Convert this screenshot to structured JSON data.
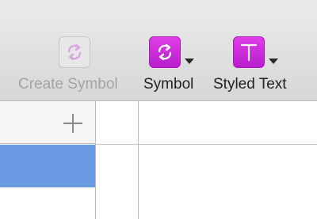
{
  "toolbar": {
    "create_symbol": {
      "label": "Create Symbol",
      "icon": "symbol-refresh-icon",
      "enabled": false
    },
    "symbol": {
      "label": "Symbol",
      "icon": "symbol-refresh-icon",
      "enabled": true
    },
    "styled_text": {
      "label": "Styled Text",
      "icon": "text-t-icon",
      "enabled": true
    }
  },
  "colors": {
    "accent": "#c62ed8",
    "selection": "#6a9be3",
    "disabled_text": "#a3a3a3"
  }
}
